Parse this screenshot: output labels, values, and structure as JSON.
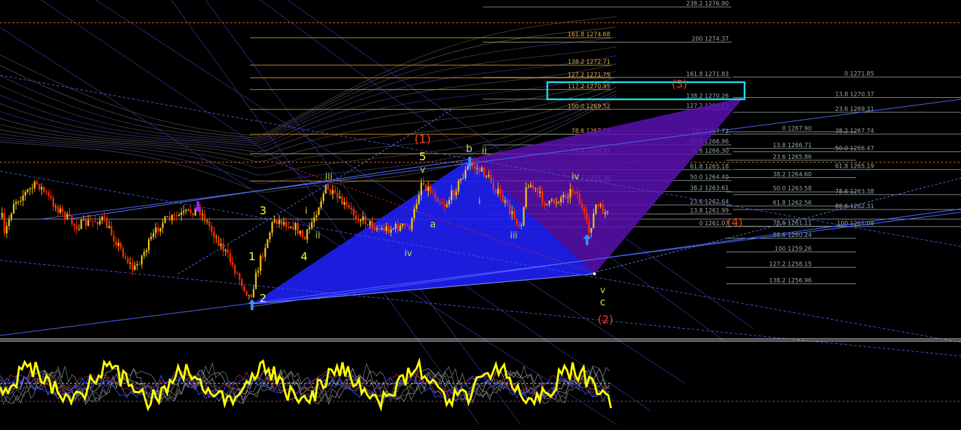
{
  "chart_data": {
    "type": "candlestick",
    "y_range": [
      1255.8,
      1277.4
    ],
    "colors": {
      "up_candle": "#f0c018",
      "down_candle": "#ff2a00",
      "fib_orange": "#c58a2a",
      "fib_grey": "#7f8a8a",
      "blue_triangle": "#1e1ef0",
      "purple_triangle": "#5a10b0",
      "target_box": "#17e3f0",
      "oscillator": "#ffff00",
      "label_red": "#ff3a10",
      "label_yellow": "#ffff33",
      "label_green": "#b6e04a"
    },
    "fib_levels_left": [
      {
        "label": "161.8",
        "value": "1274.68"
      },
      {
        "label": "138.2",
        "value": "1272.71"
      },
      {
        "label": "127.2",
        "value": "1271.79"
      },
      {
        "label": "117.2",
        "value": "1270.95"
      },
      {
        "label": "100.0",
        "value": "1269.52"
      },
      {
        "label": "78.6",
        "value": "1267.73"
      },
      {
        "label": "61.8",
        "value": "1266.32"
      },
      {
        "label": "38.2",
        "value": "1264.36"
      }
    ],
    "fib_levels_mid": [
      {
        "label": "238.2",
        "value": "1276.90"
      },
      {
        "label": "200",
        "value": "1274.37"
      },
      {
        "label": "161.8",
        "value": "1271.83"
      },
      {
        "label": "138.2",
        "value": "1270.26"
      },
      {
        "label": "127.2",
        "value": "1269.53"
      },
      {
        "label": "100",
        "value": "1267.72"
      },
      {
        "label": "88.6",
        "value": "1266.96"
      },
      {
        "label": "78.6",
        "value": "1266.30"
      },
      {
        "label": "61.8",
        "value": "1265.18"
      },
      {
        "label": "50.0",
        "value": "1264.40"
      },
      {
        "label": "38.2",
        "value": "1263.61"
      },
      {
        "label": "23.6",
        "value": "1262.64"
      },
      {
        "label": "13.8",
        "value": "1261.99"
      },
      {
        "label": "0",
        "value": "1261.07"
      }
    ],
    "fib_levels_mid2": [
      {
        "label": "0",
        "value": "1267.90"
      },
      {
        "label": "13.8",
        "value": "1266.71"
      },
      {
        "label": "23.6",
        "value": "1265.86"
      },
      {
        "label": "38.2",
        "value": "1264.60"
      },
      {
        "label": "50.0",
        "value": "1263.58"
      },
      {
        "label": "61.8",
        "value": "1262.56"
      },
      {
        "label": "78.6",
        "value": "1261.11"
      },
      {
        "label": "88.6",
        "value": "1260.24"
      },
      {
        "label": "100",
        "value": "1259.26"
      },
      {
        "label": "127.2",
        "value": "1258.15"
      },
      {
        "label": "138.2",
        "value": "1256.96"
      }
    ],
    "fib_levels_right": [
      {
        "label": "0",
        "value": "1271.85"
      },
      {
        "label": "13.8",
        "value": "1270.37"
      },
      {
        "label": "23.6",
        "value": "1269.31"
      },
      {
        "label": "38.2",
        "value": "1267.74"
      },
      {
        "label": "50.0",
        "value": "1266.47"
      },
      {
        "label": "61.8",
        "value": "1265.19"
      },
      {
        "label": "78.6",
        "value": "1263.38"
      },
      {
        "label": "88.6",
        "value": "1262.31"
      },
      {
        "label": "100",
        "value": "1261.08"
      }
    ],
    "wave_labels": [
      {
        "text": "(1)",
        "color": "red"
      },
      {
        "text": "(2)",
        "color": "red"
      },
      {
        "text": "(3)",
        "color": "red"
      },
      {
        "text": "(4)",
        "color": "red"
      },
      {
        "text": "1",
        "color": "yellow"
      },
      {
        "text": "2",
        "color": "yellow"
      },
      {
        "text": "3",
        "color": "yellow"
      },
      {
        "text": "4",
        "color": "yellow"
      },
      {
        "text": "5",
        "color": "yellow"
      },
      {
        "text": "i",
        "color": "green"
      },
      {
        "text": "ii",
        "color": "green"
      },
      {
        "text": "iii",
        "color": "green"
      },
      {
        "text": "iv",
        "color": "green"
      },
      {
        "text": "v",
        "color": "green"
      },
      {
        "text": "a",
        "color": "green"
      },
      {
        "text": "b",
        "color": "green"
      },
      {
        "text": "c",
        "color": "green"
      },
      {
        "text": "ii",
        "color": "green"
      },
      {
        "text": "i",
        "color": "green"
      },
      {
        "text": "iii",
        "color": "green"
      },
      {
        "text": "iv",
        "color": "green"
      },
      {
        "text": "v",
        "color": "green"
      }
    ],
    "arrows": [
      {
        "icon": "up-arrow-icon",
        "color": "#3a8aff"
      },
      {
        "icon": "down-arrow-icon",
        "color": "#3a8aff"
      },
      {
        "icon": "up-arrow-icon",
        "color": "#3a8aff"
      },
      {
        "icon": "down-arrow-icon",
        "color": "#a020f0"
      }
    ]
  }
}
